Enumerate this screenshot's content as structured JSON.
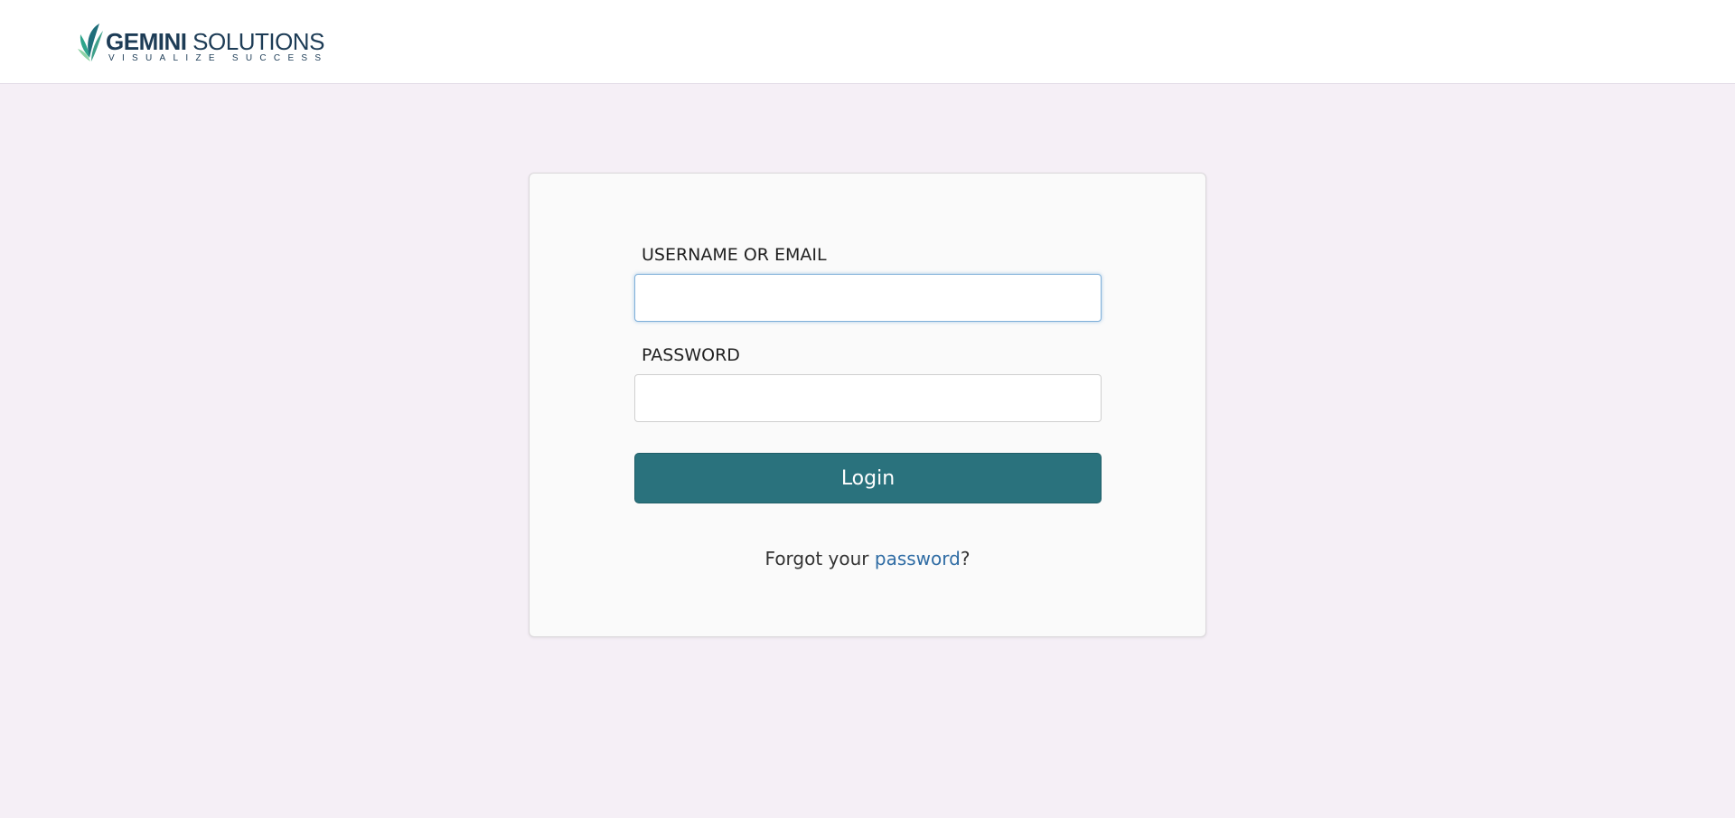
{
  "brand": {
    "name_bold": "GEMINI",
    "name_regular": " SOLUTIONS",
    "tagline": "VISUALIZE SUCCESS",
    "icon": "leaf-logo-icon",
    "colors": {
      "navy": "#1d3c56",
      "leaf_dark": "#1f6e7a",
      "leaf_mid": "#2ea58b",
      "leaf_light": "#8fd3a6"
    }
  },
  "login_form": {
    "username_label": "USERNAME OR EMAIL",
    "username_value": "",
    "password_label": "PASSWORD",
    "password_value": "",
    "login_button_label": "Login",
    "forgot_prefix": "Forgot your ",
    "forgot_link": "password",
    "forgot_suffix": "?"
  },
  "colors": {
    "page_background": "#f5eff6",
    "button": "#2a727d",
    "link": "#2f6ca4"
  }
}
